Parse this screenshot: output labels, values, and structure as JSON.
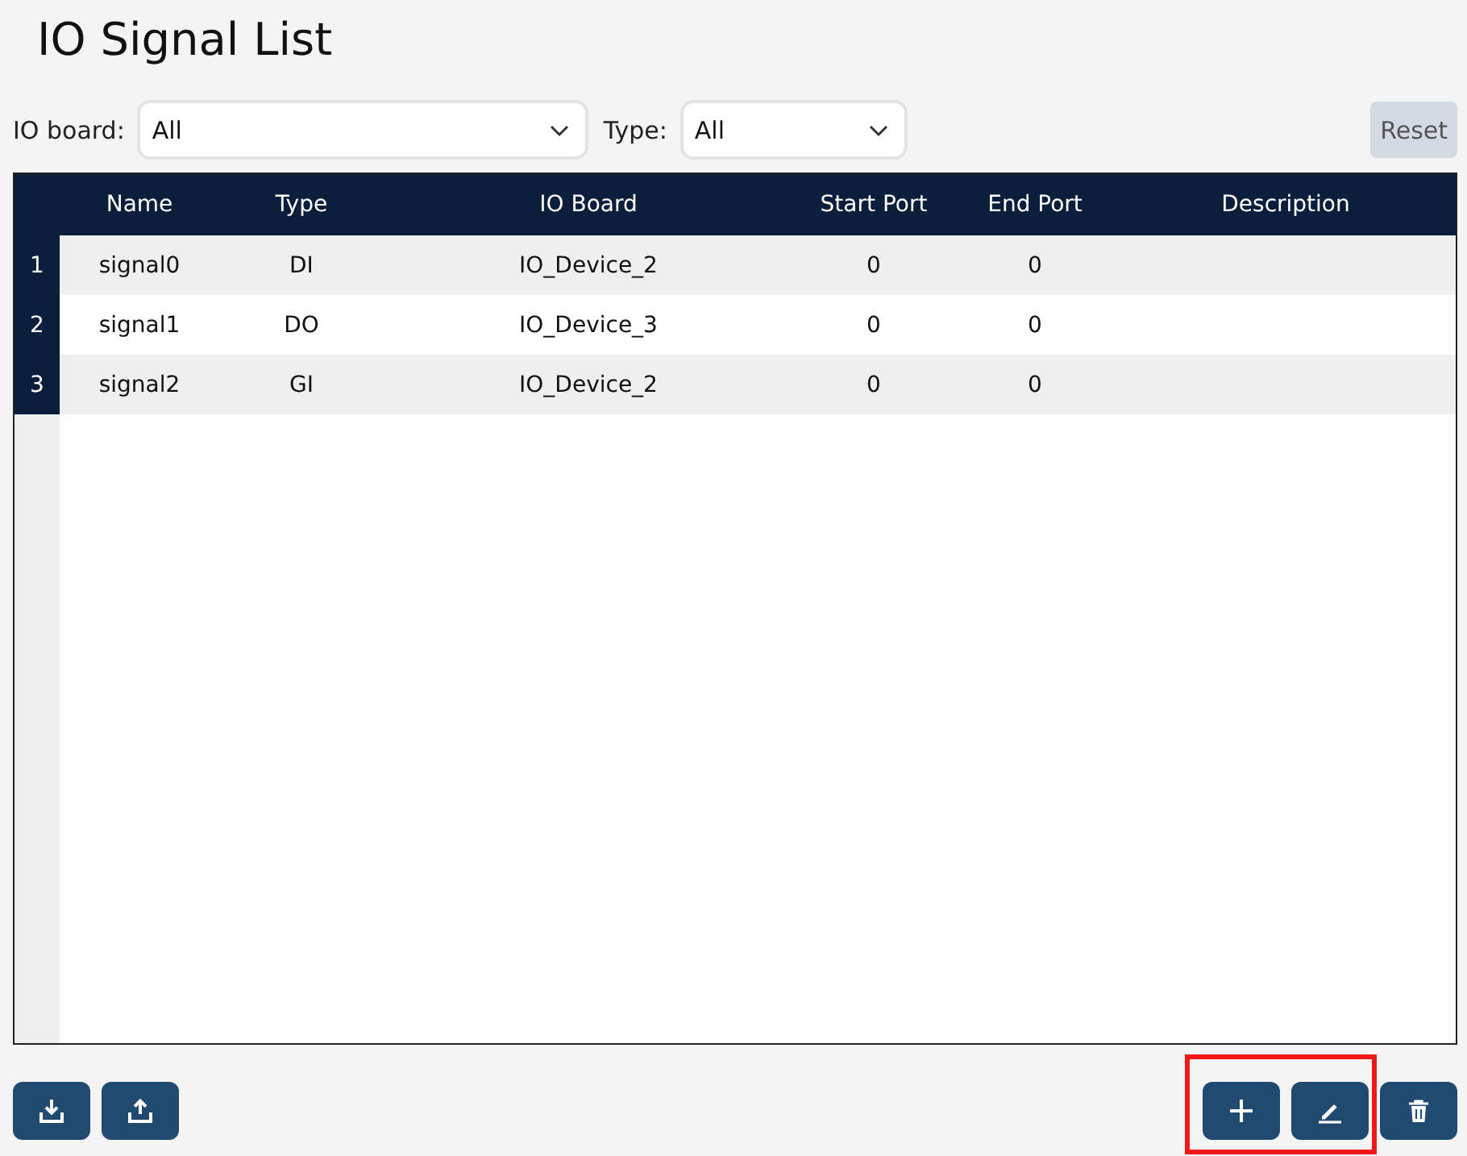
{
  "title": "IO Signal List",
  "filters": [
    {
      "label": "IO board:",
      "value": "All"
    },
    {
      "label": "Type:",
      "value": "All"
    }
  ],
  "reset_button": {
    "label": "Reset"
  },
  "table": {
    "columns": [
      "Name",
      "Type",
      "IO Board",
      "Start Port",
      "End Port",
      "Description"
    ],
    "rows": [
      {
        "number": "1",
        "cells": [
          "signal0",
          "DI",
          "IO_Device_2",
          "0",
          "0"
        ]
      },
      {
        "number": "2",
        "cells": [
          "signal1",
          "DO",
          "IO_Device_3",
          "0",
          "0"
        ]
      },
      {
        "number": "3",
        "cells": [
          "signal2",
          "GI",
          "IO_Device_2",
          "0",
          "0"
        ]
      }
    ]
  },
  "bottom_bar": {
    "left_buttons": [
      {
        "kind": "import"
      },
      {
        "kind": "export"
      }
    ],
    "right_buttons": [
      {
        "kind": "add",
        "highlighted": true
      },
      {
        "kind": "edit",
        "highlighted": true
      },
      {
        "kind": "delete",
        "highlighted": false
      }
    ]
  }
}
